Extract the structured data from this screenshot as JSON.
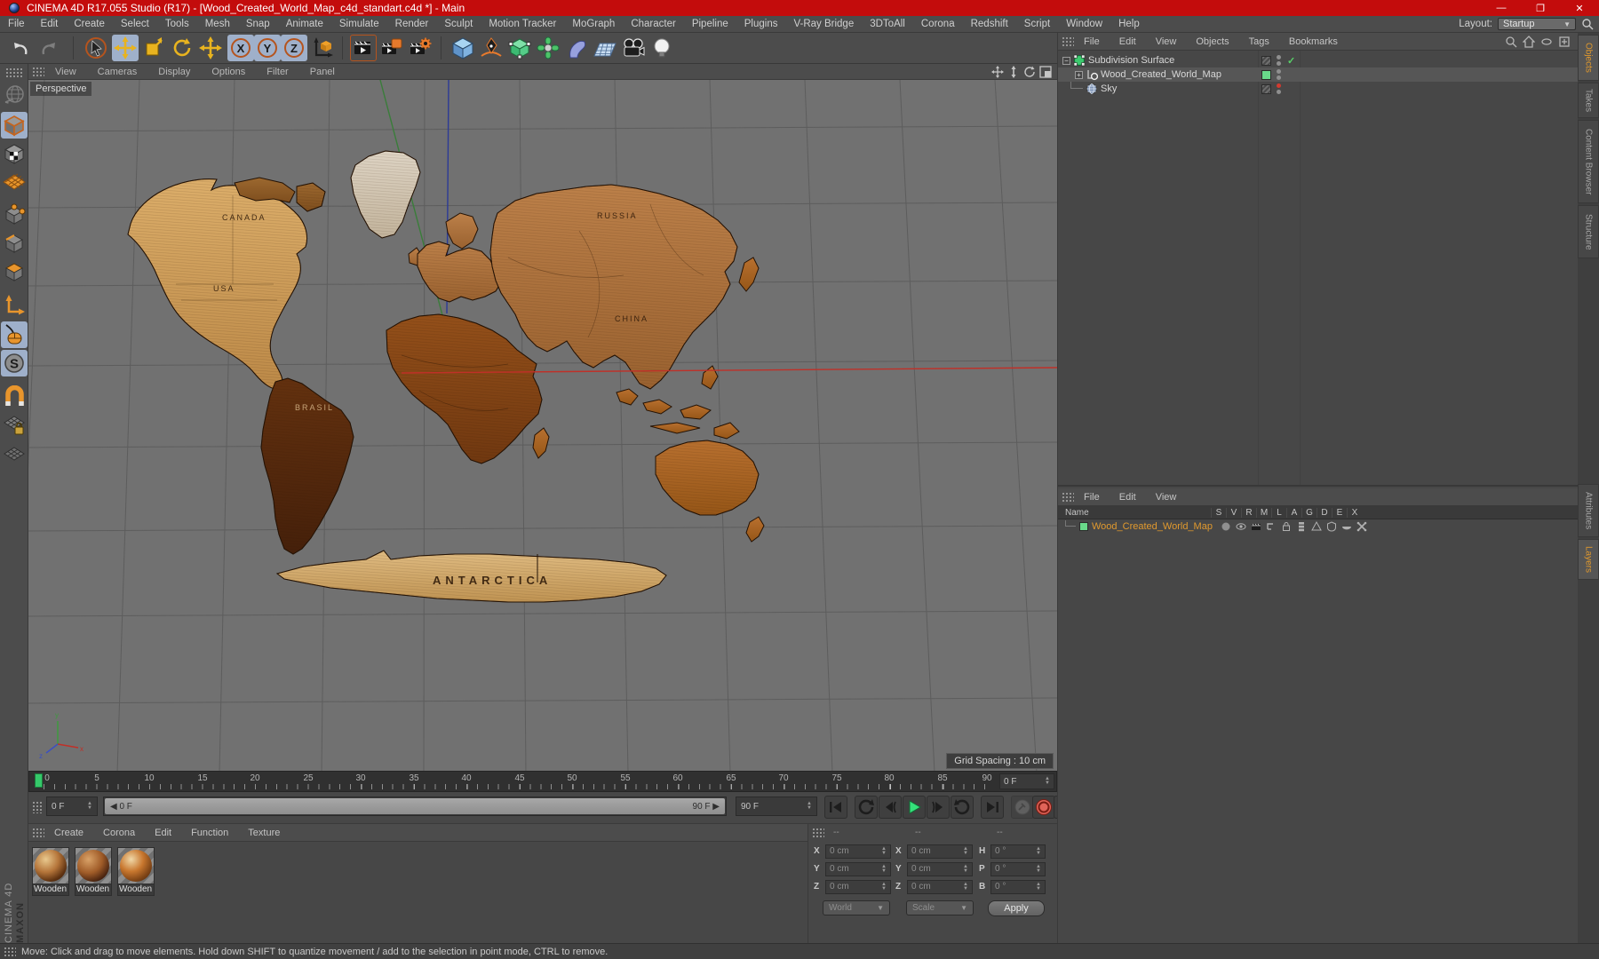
{
  "window": {
    "title": "CINEMA 4D R17.055 Studio (R17) - [Wood_Created_World_Map_c4d_standart.c4d *] - Main",
    "minimize": "—",
    "maximize": "❐",
    "close": "✕"
  },
  "menu_bar": {
    "items": [
      "File",
      "Edit",
      "Create",
      "Select",
      "Tools",
      "Mesh",
      "Snap",
      "Animate",
      "Simulate",
      "Render",
      "Sculpt",
      "Motion Tracker",
      "MoGraph",
      "Character",
      "Pipeline",
      "Plugins",
      "V-Ray Bridge",
      "3DToAll",
      "Corona",
      "Redshift",
      "Script",
      "Window",
      "Help"
    ],
    "layout_label": "Layout:",
    "layout_value": "Startup"
  },
  "toolbar_icons": [
    "undo",
    "redo",
    "live-selection",
    "move",
    "scale",
    "rotate",
    "recent-tool",
    "axis-x-lock",
    "axis-y-lock",
    "axis-z-lock",
    "coordinate-system",
    "render-view",
    "render-to-picture-viewer",
    "edit-render-settings",
    "add-primitive-cube",
    "spline-pen",
    "generators-subdivision",
    "mograph",
    "deformers",
    "environment-floor",
    "camera",
    "light"
  ],
  "palette_icons": [
    "convert",
    "model-mode",
    "texture-mode",
    "workplane-mode",
    "points-mode",
    "edges-mode",
    "polygons-mode",
    "axis-mode",
    "viewport-solo",
    "snap-settings",
    "enable-snap",
    "lock-workplane",
    "workplane"
  ],
  "viewport": {
    "menu": [
      "View",
      "Cameras",
      "Display",
      "Options",
      "Filter",
      "Panel"
    ],
    "camera_label": "Perspective",
    "grid_spacing_label": "Grid Spacing : 10 cm",
    "map_labels": {
      "canada": "CANADA",
      "usa": "USA",
      "brasil": "BRASIL",
      "russia": "RUSSIA",
      "china": "CHINA",
      "antarctica": "ANTARCTICA"
    },
    "axis_gizmo": {
      "x": "x",
      "y": "y",
      "z": "z"
    }
  },
  "object_manager": {
    "menu": [
      "File",
      "Edit",
      "View",
      "Objects",
      "Tags",
      "Bookmarks"
    ],
    "objects": [
      {
        "name": "Subdivision Surface",
        "check": "✓"
      },
      {
        "name": "Wood_Created_World_Map"
      },
      {
        "name": "Sky"
      }
    ]
  },
  "layer_manager": {
    "menu": [
      "File",
      "Edit",
      "View"
    ],
    "name_header": "Name",
    "columns": [
      "S",
      "V",
      "R",
      "M",
      "L",
      "A",
      "G",
      "D",
      "E",
      "X"
    ],
    "rows": [
      {
        "name": "Wood_Created_World_Map"
      }
    ]
  },
  "side_tabs": {
    "top": [
      "Objects",
      "Takes",
      "Content Browser",
      "Structure"
    ],
    "bottom": [
      "Attributes",
      "Layers"
    ]
  },
  "timeline": {
    "ticks": [
      "0",
      "5",
      "10",
      "15",
      "20",
      "25",
      "30",
      "35",
      "40",
      "45",
      "50",
      "55",
      "60",
      "65",
      "70",
      "75",
      "80",
      "85",
      "90"
    ],
    "frame_field": "0 F",
    "current_frame": "0 F",
    "range_start": "0 F",
    "range_end": "90 F",
    "end_frame": "90 F"
  },
  "materials": {
    "menu": [
      "Create",
      "Corona",
      "Edit",
      "Function",
      "Texture"
    ],
    "items": [
      {
        "label": "Wooden"
      },
      {
        "label": "Wooden"
      },
      {
        "label": "Wooden"
      }
    ]
  },
  "coordinates": {
    "headers": [
      "--",
      "--",
      "--"
    ],
    "position": [
      {
        "label": "X",
        "value": "0 cm"
      },
      {
        "label": "Y",
        "value": "0 cm"
      },
      {
        "label": "Z",
        "value": "0 cm"
      }
    ],
    "size": [
      {
        "label": "X",
        "value": "0 cm"
      },
      {
        "label": "Y",
        "value": "0 cm"
      },
      {
        "label": "Z",
        "value": "0 cm"
      }
    ],
    "rotation": [
      {
        "label": "H",
        "value": "0 °"
      },
      {
        "label": "P",
        "value": "0 °"
      },
      {
        "label": "B",
        "value": "0 °"
      }
    ],
    "mode_dropdown": "World",
    "action_dropdown": "Scale",
    "apply_label": "Apply"
  },
  "status_bar": {
    "message": "Move: Click and drag to move elements. Hold down SHIFT to quantize movement / add to the selection in point mode, CTRL to remove."
  },
  "branding": {
    "maxon": "MAXON",
    "cinema": "CINEMA 4D"
  },
  "colors": {
    "titlebar_red": "#c30c0c",
    "highlight_blue": "#9fb0ca",
    "accent_orange": "#e0992e",
    "tool_yellow": "#e8b31f",
    "play_green": "#35e07a",
    "object_green": "#69d98a",
    "viewport_gray": "#717171",
    "axis_red": "#c03028",
    "axis_green": "#3a7d3a",
    "axis_blue": "#2c3a96"
  }
}
